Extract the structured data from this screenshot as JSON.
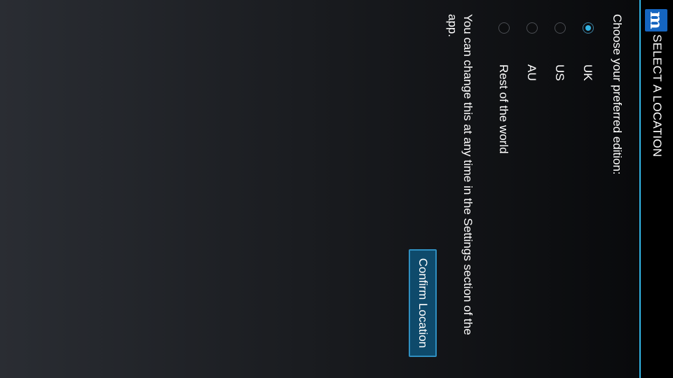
{
  "header": {
    "logo_letter": "m",
    "title": "SELECT A LOCATION"
  },
  "prompt": "Choose your preferred edition:",
  "options": [
    {
      "label": "UK",
      "selected": true
    },
    {
      "label": "US",
      "selected": false
    },
    {
      "label": "AU",
      "selected": false
    },
    {
      "label": "Rest of the world",
      "selected": false
    }
  ],
  "note": "You can change this at any time in the Settings section of the app.",
  "confirm_button": "Confirm Location",
  "colors": {
    "accent": "#33b5e5",
    "logo_bg": "#1565c0",
    "button_bg": "#0e4a6b",
    "button_border": "#2f8fc0",
    "titlebar_bg": "#000000"
  },
  "icons": {
    "app_logo": "app-logo-icon",
    "radio": "radio-icon"
  }
}
